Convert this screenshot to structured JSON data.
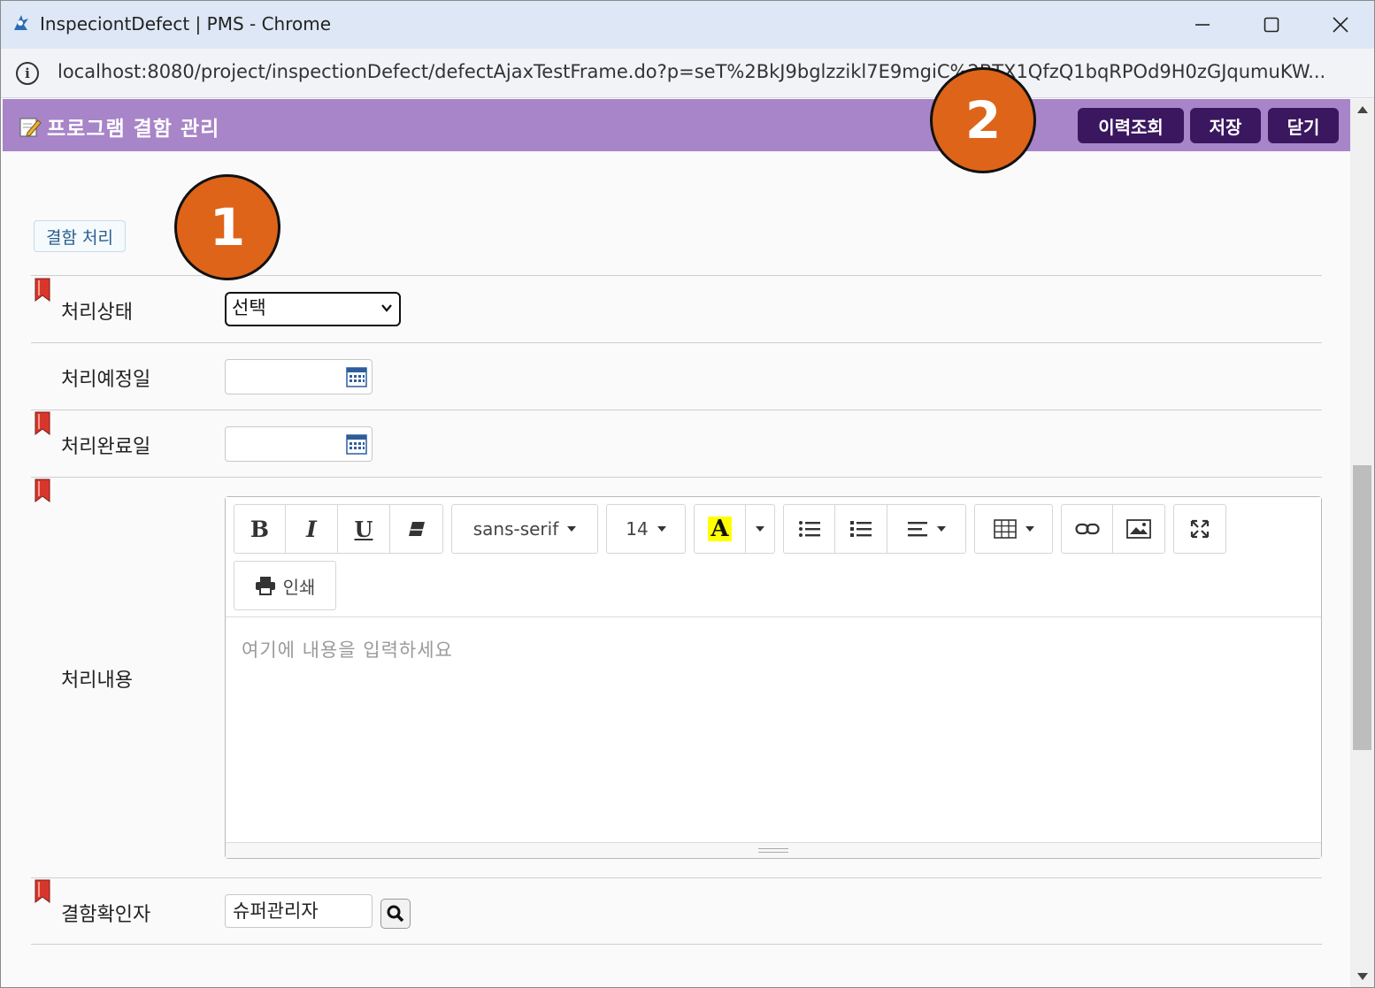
{
  "window": {
    "title": "InspeciontDefect | PMS - Chrome",
    "url": "localhost:8080/project/inspectionDefect/defectAjaxTestFrame.do?p=seT%2BkJ9bglzzikl7E9mgiC%2BTX1QfzQ1bqRPOd9H0zGJqumuKW..."
  },
  "header": {
    "title": "프로그램 결함 관리",
    "buttons": {
      "history": "이력조회",
      "save": "저장",
      "close": "닫기"
    },
    "bg_color": "#a884c8",
    "button_color": "#3b1760"
  },
  "callouts": [
    "1",
    "2"
  ],
  "section": {
    "label": "결함 처리"
  },
  "form": {
    "status": {
      "label": "처리상태",
      "value": "선택"
    },
    "planned_date": {
      "label": "처리예정일",
      "value": ""
    },
    "completed_date": {
      "label": "처리완료일",
      "value": ""
    },
    "content": {
      "label": "처리내용",
      "placeholder": "여기에 내용을 입력하세요",
      "toolbar": {
        "font_family": "sans-serif",
        "font_size": "14",
        "print_label": "인쇄"
      }
    },
    "confirmer": {
      "label": "결함확인자",
      "value": "슈퍼관리자"
    }
  }
}
